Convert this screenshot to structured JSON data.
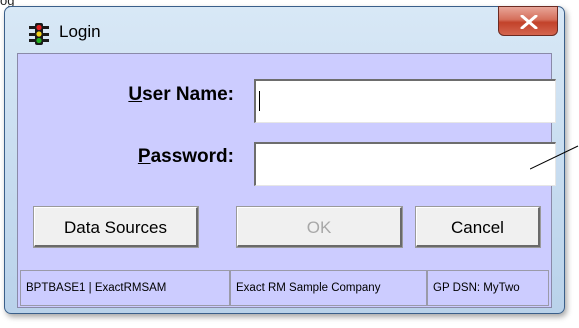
{
  "window": {
    "title": "Login",
    "close_symbol": "X",
    "app_icon": "traffic-light-icon"
  },
  "form": {
    "username_label_accel": "U",
    "username_label_rest": "ser Name:",
    "username_value": "",
    "password_label_accel": "P",
    "password_label_rest": "assword:",
    "password_value": ""
  },
  "buttons": {
    "data_sources": "Data Sources",
    "ok": "OK",
    "cancel": "Cancel"
  },
  "status": {
    "database": "BPTBASE1 | ExactRMSAM",
    "company": "Exact RM Sample Company",
    "gp_dsn": "GP DSN: MyTwo"
  }
}
